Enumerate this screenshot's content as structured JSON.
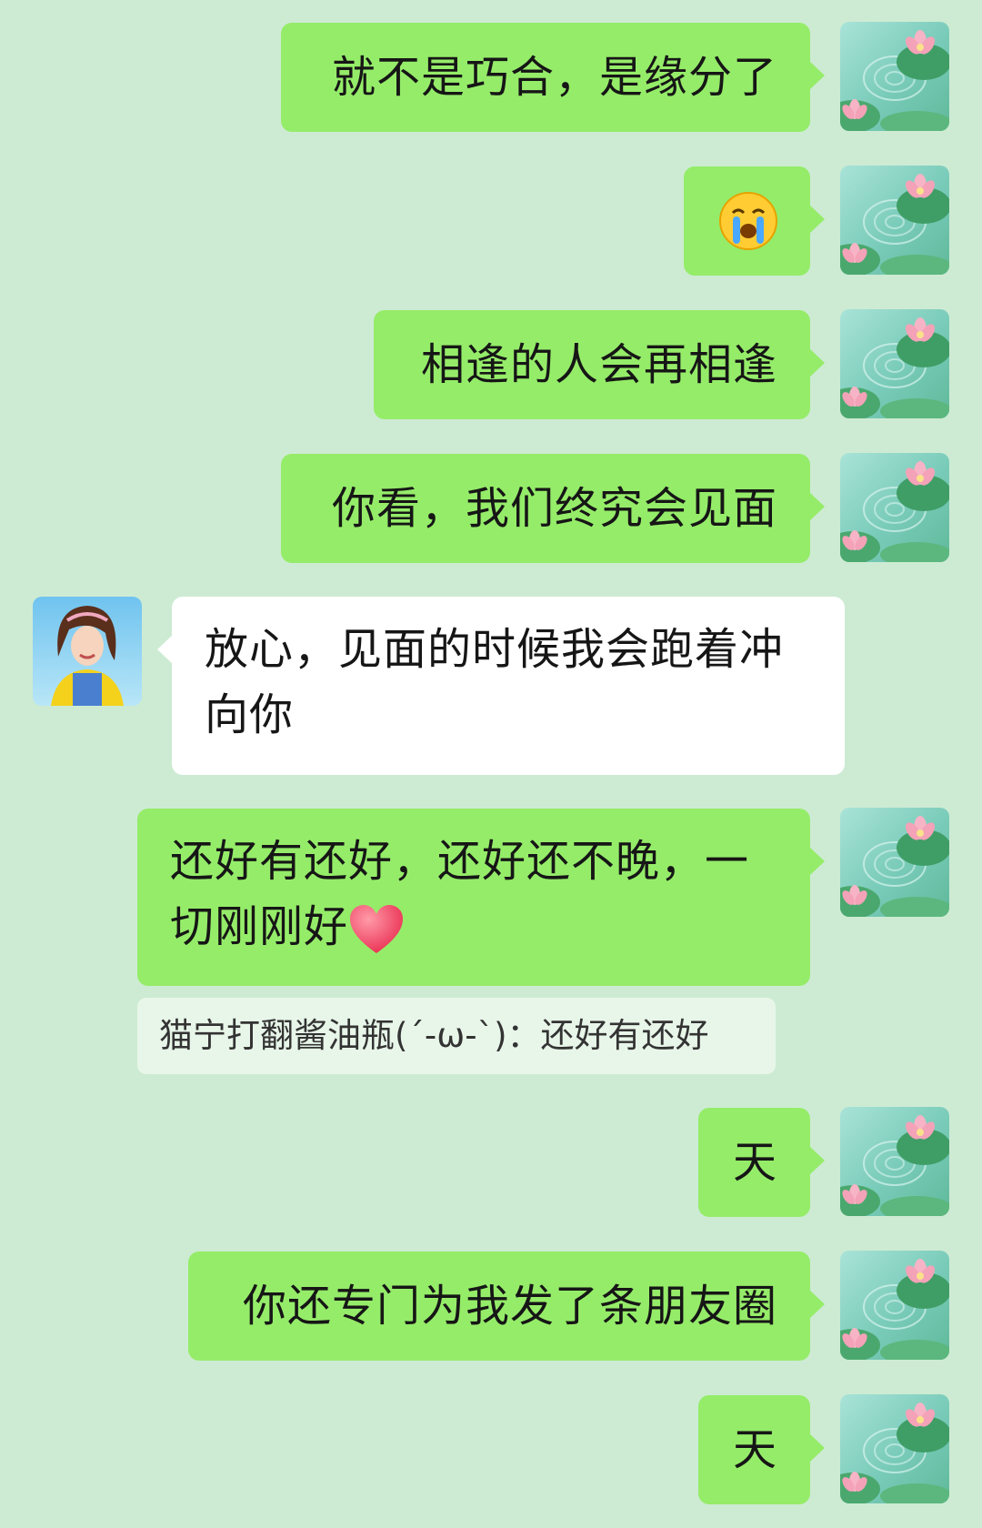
{
  "theme": {
    "background": "#cdebd3",
    "bubble_green": "#95ec69",
    "bubble_white": "#ffffff"
  },
  "messages": [
    {
      "side": "me",
      "text": "就不是巧合，是缘分了"
    },
    {
      "side": "me",
      "emoji": "crying-face-emoji"
    },
    {
      "side": "me",
      "text": "相逢的人会再相逢"
    },
    {
      "side": "me",
      "text": "你看，我们终究会见面"
    },
    {
      "side": "other",
      "line1": "放心，见面的时候我会跑着冲",
      "line2": "向你"
    },
    {
      "side": "me",
      "line1": "还好有还好，还好还不晚，一",
      "line2": "切刚刚好",
      "emoji": "red-heart-emoji"
    },
    {
      "type": "quote",
      "text": "猫宁打翻酱油瓶(´-ω-`)：还好有还好"
    },
    {
      "side": "me",
      "text": "天"
    },
    {
      "side": "me",
      "text": "你还专门为我发了条朋友圈"
    },
    {
      "side": "me",
      "text": "天"
    }
  ]
}
